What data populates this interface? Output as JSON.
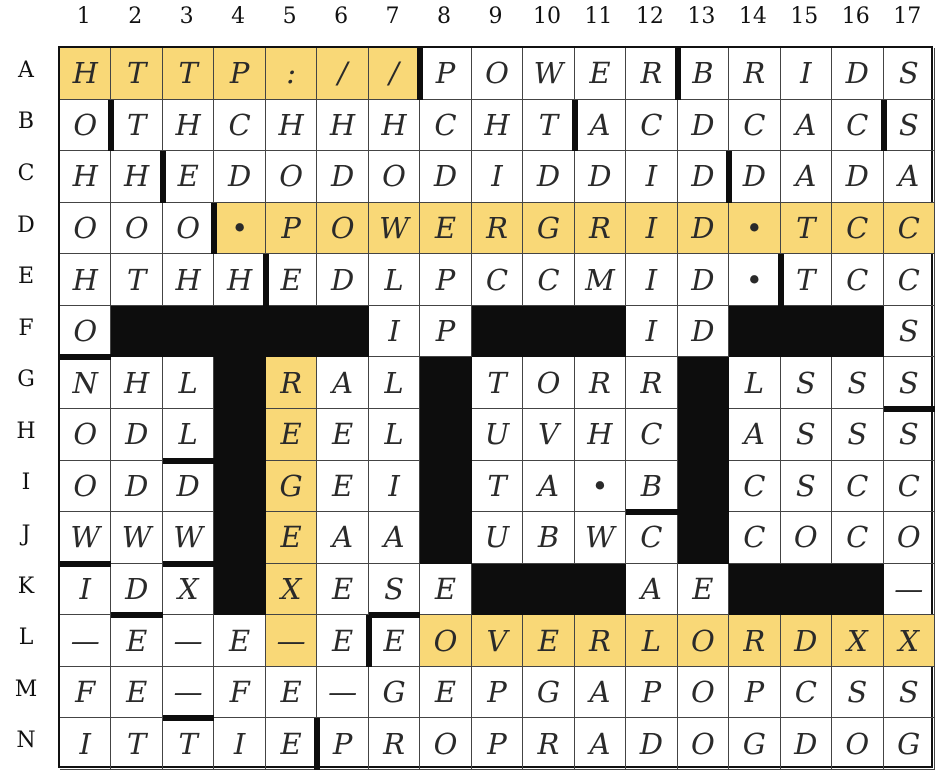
{
  "puzzle": {
    "columns": [
      "1",
      "2",
      "3",
      "4",
      "5",
      "6",
      "7",
      "8",
      "9",
      "10",
      "11",
      "12",
      "13",
      "14",
      "15",
      "16",
      "17"
    ],
    "rows": [
      "A",
      "B",
      "C",
      "D",
      "E",
      "F",
      "G",
      "H",
      "I",
      "J",
      "K",
      "L",
      "M",
      "N"
    ],
    "cells": [
      "HTTP://POWERBRIDS",
      "OTHCHHHCHTACDCACS",
      "HHEDODODIDDIDDADA",
      "OOO•POWERGRID•TCC",
      "HTHHEDLPCCMID•TCC",
      "O######IP###ID##S",
      "NHL#RAL#TORR#LSSS",
      "ODL#EEL#UVHC#ASSS",
      "ODD#GEI#TA•B#CSCC",
      "WWW#EAA#UBWC#COCO",
      "IDX#XESE####AE###-",
      "-E-E-EEEOVERLORDXX",
      "FE-FE-GEPGAP OPCSS",
      "ITTIEPROPRADOGDOG"
    ],
    "highlights": [
      "A1",
      "A2",
      "A3",
      "A4",
      "A5",
      "A6",
      "A7",
      "D4",
      "D5",
      "D6",
      "D7",
      "D8",
      "D9",
      "D10",
      "D11",
      "D12",
      "D13",
      "D14",
      "D15",
      "D16",
      "D17",
      "G5",
      "H5",
      "I5",
      "J5",
      "K5",
      "L5",
      "L8",
      "L9",
      "L10",
      "L11",
      "L12",
      "L13",
      "L14",
      "L15",
      "L16",
      "L17"
    ],
    "colors": {
      "highlight": "#f9d877",
      "block": "#0d0d0d",
      "line": "#444444"
    }
  },
  "grid_text": {
    "A": [
      "H",
      "T",
      "T",
      "P",
      ":",
      "/",
      "/",
      "P",
      "O",
      "W",
      "E",
      "R",
      "B",
      "R",
      "I",
      "D",
      "S"
    ],
    "B": [
      "O",
      "T",
      "H",
      "C",
      "H",
      "H",
      "H",
      "C",
      "H",
      "T",
      "A",
      "C",
      "D",
      "C",
      "A",
      "C",
      "S"
    ],
    "C": [
      "H",
      "H",
      "E",
      "D",
      "O",
      "D",
      "O",
      "D",
      "I",
      "D",
      "D",
      "I",
      "D",
      "D",
      "A",
      "D",
      "A"
    ],
    "D": [
      "O",
      "O",
      "O",
      "•",
      "P",
      "O",
      "W",
      "E",
      "R",
      "G",
      "R",
      "I",
      "D",
      "•",
      "T",
      "C",
      "C"
    ],
    "E": [
      "H",
      "T",
      "H",
      "H",
      "E",
      "D",
      "L",
      "P",
      "C",
      "C",
      "M",
      "I",
      "D",
      "•",
      "T",
      "C",
      "C"
    ],
    "F": [
      "O",
      "",
      "",
      "",
      "",
      "",
      "I",
      "P",
      "",
      "",
      "",
      "I",
      "D",
      "",
      "",
      "",
      "S"
    ],
    "G": [
      "N",
      "H",
      "L",
      "",
      "R",
      "A",
      "L",
      "",
      "T",
      "O",
      "R",
      "R",
      "",
      "L",
      "S",
      "S",
      "S"
    ],
    "H": [
      "O",
      "D",
      "L",
      "",
      "E",
      "E",
      "L",
      "",
      "U",
      "V",
      "H",
      "C",
      "",
      "A",
      "S",
      "S",
      "S"
    ],
    "I": [
      "O",
      "D",
      "D",
      "",
      "G",
      "E",
      "I",
      "",
      "T",
      "A",
      "•",
      "B",
      "",
      "C",
      "S",
      "C",
      "C"
    ],
    "J": [
      "W",
      "W",
      "W",
      "",
      "E",
      "A",
      "A",
      "",
      "U",
      "B",
      "W",
      "C",
      "",
      "C",
      "O",
      "C",
      "O"
    ],
    "K": [
      "I",
      "D",
      "X",
      "",
      "X",
      "E",
      "S",
      "E",
      "",
      "",
      "",
      "A",
      "E",
      "",
      "",
      "",
      "—"
    ],
    "L": [
      "—",
      "E",
      "—",
      "E",
      "—",
      "E",
      "E",
      "O",
      "V",
      "E",
      "R",
      "L",
      "O",
      "R",
      "D",
      "X",
      "X"
    ],
    "M": [
      "F",
      "E",
      "—",
      "F",
      "E",
      "—",
      "G",
      "E",
      "P",
      "G",
      "A",
      "P",
      "O",
      "P",
      "C",
      "S",
      "S"
    ],
    "N": [
      "I",
      "T",
      "T",
      "I",
      "E",
      "P",
      "R",
      "O",
      "P",
      "R",
      "A",
      "D",
      "O",
      "G",
      "D",
      "O",
      "G"
    ]
  },
  "blocks": [
    "F2",
    "F3",
    "F4",
    "F5",
    "F6",
    "F9",
    "F10",
    "F11",
    "F14",
    "F15",
    "F16",
    "G4",
    "G8",
    "G13",
    "H4",
    "H8",
    "H13",
    "I4",
    "I8",
    "I13",
    "J4",
    "J8",
    "J13",
    "K4",
    "K9",
    "K10",
    "K11",
    "K14",
    "K15",
    "K16"
  ]
}
